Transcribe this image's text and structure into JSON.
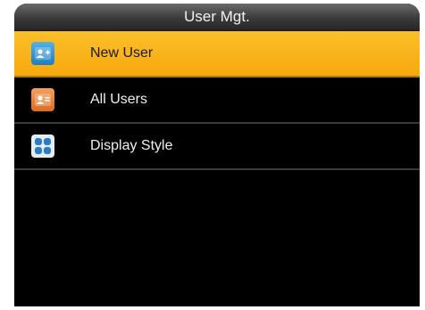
{
  "header": {
    "title": "User Mgt."
  },
  "menu": {
    "items": [
      {
        "label": "New User",
        "icon": "add-user-icon",
        "selected": true,
        "icon_color": "#2a8fd6"
      },
      {
        "label": "All Users",
        "icon": "user-card-icon",
        "selected": false,
        "icon_color": "#e8772a"
      },
      {
        "label": "Display Style",
        "icon": "grid-style-icon",
        "selected": false,
        "icon_color": "#2a7dc9"
      }
    ]
  },
  "colors": {
    "selection": "#f9b21c",
    "background": "#000000",
    "title_bar": "#3a3a3a"
  }
}
